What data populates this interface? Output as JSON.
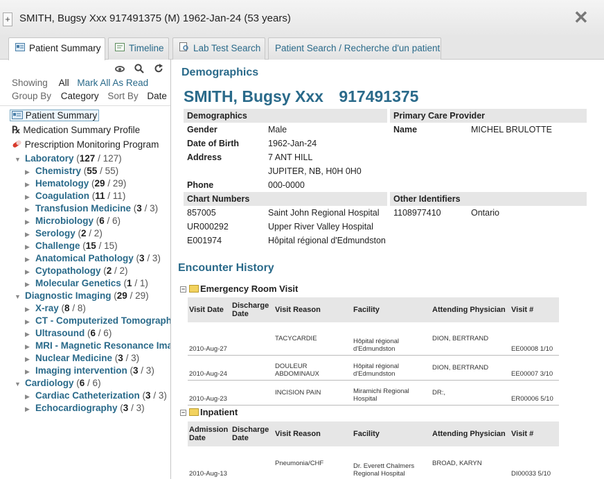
{
  "window": {
    "plus_label": "+",
    "title": "SMITH, Bugsy Xxx 917491375 (M) 1962-Jan-24 (53 years)",
    "close_label": "✕"
  },
  "tabs": [
    {
      "label": "Patient Summary",
      "icon": "summary-icon",
      "active": true
    },
    {
      "label": "Timeline",
      "icon": "timeline-icon",
      "active": false
    },
    {
      "label": "Lab Test Search",
      "icon": "search-doc-icon",
      "active": false
    },
    {
      "label": "Patient Search / Recherche d'un patient",
      "icon": "",
      "active": false
    }
  ],
  "sidebar": {
    "showing_label": "Showing",
    "showing_value": "All",
    "mark_all_label": "Mark All As Read",
    "group_by_label": "Group By",
    "group_by_value": "Category",
    "sort_by_label": "Sort By",
    "sort_by_value": "Date",
    "top_items": [
      {
        "label": "Patient Summary",
        "icon": "summary-icon"
      },
      {
        "label": "Medication Summary Profile",
        "icon": "rx-icon"
      },
      {
        "label": "Prescription Monitoring Program",
        "icon": "pill-icon"
      }
    ],
    "tree": [
      {
        "label": "Laboratory",
        "count": "127",
        "total": "/ 127",
        "level": 0,
        "expanded": true
      },
      {
        "label": "Chemistry",
        "count": "55",
        "total": "/ 55",
        "level": 1
      },
      {
        "label": "Hematology",
        "count": "29",
        "total": "/ 29",
        "level": 1
      },
      {
        "label": "Coagulation",
        "count": "11",
        "total": "/ 11",
        "level": 1
      },
      {
        "label": "Transfusion Medicine",
        "count": "3",
        "total": "/ 3",
        "level": 1
      },
      {
        "label": "Microbiology",
        "count": "6",
        "total": "/ 6",
        "level": 1
      },
      {
        "label": "Serology",
        "count": "2",
        "total": "/ 2",
        "level": 1
      },
      {
        "label": "Challenge",
        "count": "15",
        "total": "/ 15",
        "level": 1
      },
      {
        "label": "Anatomical Pathology",
        "count": "3",
        "total": "/ 3",
        "level": 1
      },
      {
        "label": "Cytopathology",
        "count": "2",
        "total": "/ 2",
        "level": 1
      },
      {
        "label": "Molecular Genetics",
        "count": "1",
        "total": "/ 1",
        "level": 1
      },
      {
        "label": "Diagnostic Imaging",
        "count": "29",
        "total": "/ 29",
        "level": 0,
        "expanded": true
      },
      {
        "label": "X-ray",
        "count": "8",
        "total": "/ 8",
        "level": 1
      },
      {
        "label": "CT - Computerized Tomography",
        "count": "",
        "total": "",
        "level": 1
      },
      {
        "label": "Ultrasound",
        "count": "6",
        "total": "/ 6",
        "level": 1
      },
      {
        "label": "MRI - Magnetic Resonance Imag",
        "count": "",
        "total": "",
        "level": 1
      },
      {
        "label": "Nuclear Medicine",
        "count": "3",
        "total": "/ 3",
        "level": 1
      },
      {
        "label": "Imaging intervention",
        "count": "3",
        "total": "/ 3",
        "level": 1
      },
      {
        "label": "Cardiology",
        "count": "6",
        "total": "/ 6",
        "level": 0,
        "expanded": true
      },
      {
        "label": "Cardiac Catheterization",
        "count": "3",
        "total": "/ 3",
        "level": 1
      },
      {
        "label": "Echocardiography",
        "count": "3",
        "total": "/ 3",
        "level": 1
      }
    ]
  },
  "demographics": {
    "section_title": "Demographics",
    "patient_name": "SMITH, Bugsy Xxx",
    "patient_id": "917491375",
    "header": "Demographics",
    "gender_label": "Gender",
    "gender": "Male",
    "dob_label": "Date of Birth",
    "dob": "1962-Jan-24",
    "address_label": "Address",
    "address_line1": "7 ANT HILL",
    "address_line2": "JUPITER, NB, H0H 0H0",
    "phone_label": "Phone",
    "phone": "000-0000",
    "pcp_header": "Primary Care Provider",
    "pcp_name_label": "Name",
    "pcp_name": "MICHEL BRULOTTE",
    "chart_header": "Chart Numbers",
    "charts": [
      {
        "number": "857005",
        "facility": "Saint John Regional Hospital"
      },
      {
        "number": "UR000292",
        "facility": "Upper River Valley Hospital"
      },
      {
        "number": "E001974",
        "facility": "Hôpital régional d'Edmundston"
      }
    ],
    "other_header": "Other Identifiers",
    "other_id": "1108977410",
    "other_region": "Ontario"
  },
  "encounters": {
    "section_title": "Encounter History",
    "groups": [
      {
        "title": "Emergency Room Visit",
        "columns": [
          "Visit Date",
          "Discharge Date",
          "Visit Reason",
          "Facility",
          "Attending Physician",
          "Visit #"
        ],
        "rows": [
          [
            "2010-Aug-27",
            "",
            "TACYCARDIE",
            "Hôpital régional d'Edmundston",
            "DION, BERTRAND",
            "EE00008 1/10"
          ],
          [
            "2010-Aug-24",
            "",
            "DOULEUR ABDOMINAUX",
            "Hôpital régional d'Edmundston",
            "DION, BERTRAND",
            "EE00007 3/10"
          ],
          [
            "2010-Aug-23",
            "",
            "INCISION PAIN",
            "Miramichi Regional Hospital",
            "DR:,",
            "ER00006 5/10"
          ]
        ]
      },
      {
        "title": "Inpatient",
        "columns": [
          "Admission Date",
          "Discharge Date",
          "Visit Reason",
          "Facility",
          "Attending Physician",
          "Visit #"
        ],
        "rows": [
          [
            "2010-Aug-13",
            "",
            "Pneumonia/CHF",
            "Dr. Everett Chalmers Regional Hospital",
            "BROAD, KARYN",
            "DI00033 5/10"
          ]
        ]
      }
    ]
  }
}
